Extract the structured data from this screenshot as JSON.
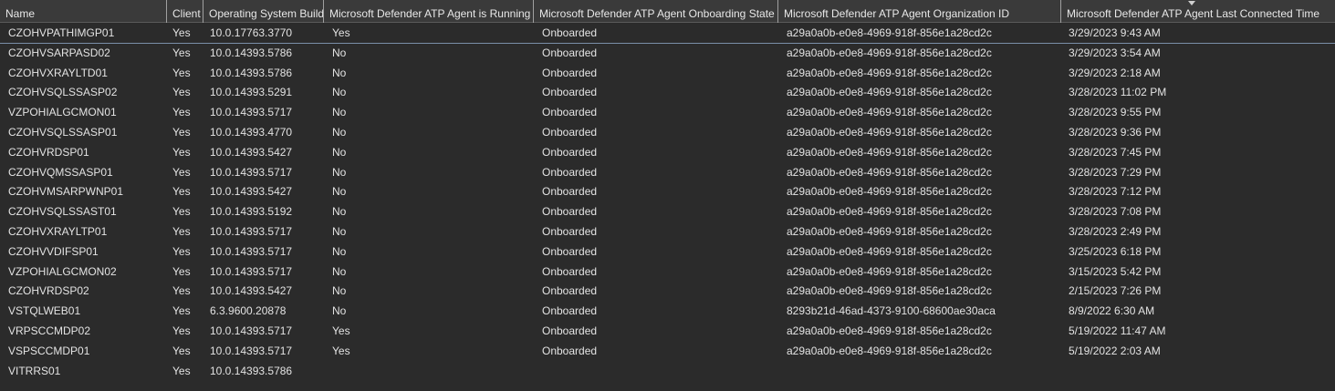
{
  "columns": [
    "Name",
    "Client",
    "Operating System Build",
    "Microsoft Defender ATP Agent is Running",
    "Microsoft Defender ATP Agent Onboarding State",
    "Microsoft Defender ATP Agent Organization ID",
    "Microsoft Defender ATP Agent Last Connected Time"
  ],
  "sort_indicator": "sort-descending-icon",
  "rows": [
    {
      "name": "CZOHVPATHIMGP01",
      "client": "Yes",
      "os_build": "10.0.17763.3770",
      "running": "Yes",
      "onboarding": "Onboarded",
      "org_id": "a29a0a0b-e0e8-4969-918f-856e1a28cd2c",
      "last_connected": "3/29/2023 9:43 AM"
    },
    {
      "name": "CZOHVSARPASD02",
      "client": "Yes",
      "os_build": "10.0.14393.5786",
      "running": "No",
      "onboarding": "Onboarded",
      "org_id": "a29a0a0b-e0e8-4969-918f-856e1a28cd2c",
      "last_connected": "3/29/2023 3:54 AM"
    },
    {
      "name": "CZOHVXRAYLTD01",
      "client": "Yes",
      "os_build": "10.0.14393.5786",
      "running": "No",
      "onboarding": "Onboarded",
      "org_id": "a29a0a0b-e0e8-4969-918f-856e1a28cd2c",
      "last_connected": "3/29/2023 2:18 AM"
    },
    {
      "name": "CZOHVSQLSSASP02",
      "client": "Yes",
      "os_build": "10.0.14393.5291",
      "running": "No",
      "onboarding": "Onboarded",
      "org_id": "a29a0a0b-e0e8-4969-918f-856e1a28cd2c",
      "last_connected": "3/28/2023 11:02 PM"
    },
    {
      "name": "VZPOHIALGCMON01",
      "client": "Yes",
      "os_build": "10.0.14393.5717",
      "running": "No",
      "onboarding": "Onboarded",
      "org_id": "a29a0a0b-e0e8-4969-918f-856e1a28cd2c",
      "last_connected": "3/28/2023 9:55 PM"
    },
    {
      "name": "CZOHVSQLSSASP01",
      "client": "Yes",
      "os_build": "10.0.14393.4770",
      "running": "No",
      "onboarding": "Onboarded",
      "org_id": "a29a0a0b-e0e8-4969-918f-856e1a28cd2c",
      "last_connected": "3/28/2023 9:36 PM"
    },
    {
      "name": "CZOHVRDSP01",
      "client": "Yes",
      "os_build": "10.0.14393.5427",
      "running": "No",
      "onboarding": "Onboarded",
      "org_id": "a29a0a0b-e0e8-4969-918f-856e1a28cd2c",
      "last_connected": "3/28/2023 7:45 PM"
    },
    {
      "name": "CZOHVQMSSASP01",
      "client": "Yes",
      "os_build": "10.0.14393.5717",
      "running": "No",
      "onboarding": "Onboarded",
      "org_id": "a29a0a0b-e0e8-4969-918f-856e1a28cd2c",
      "last_connected": "3/28/2023 7:29 PM"
    },
    {
      "name": "CZOHVMSARPWNP01",
      "client": "Yes",
      "os_build": "10.0.14393.5427",
      "running": "No",
      "onboarding": "Onboarded",
      "org_id": "a29a0a0b-e0e8-4969-918f-856e1a28cd2c",
      "last_connected": "3/28/2023 7:12 PM"
    },
    {
      "name": "CZOHVSQLSSAST01",
      "client": "Yes",
      "os_build": "10.0.14393.5192",
      "running": "No",
      "onboarding": "Onboarded",
      "org_id": "a29a0a0b-e0e8-4969-918f-856e1a28cd2c",
      "last_connected": "3/28/2023 7:08 PM"
    },
    {
      "name": "CZOHVXRAYLTP01",
      "client": "Yes",
      "os_build": "10.0.14393.5717",
      "running": "No",
      "onboarding": "Onboarded",
      "org_id": "a29a0a0b-e0e8-4969-918f-856e1a28cd2c",
      "last_connected": "3/28/2023 2:49 PM"
    },
    {
      "name": "CZOHVVDIFSP01",
      "client": "Yes",
      "os_build": "10.0.14393.5717",
      "running": "No",
      "onboarding": "Onboarded",
      "org_id": "a29a0a0b-e0e8-4969-918f-856e1a28cd2c",
      "last_connected": "3/25/2023 6:18 PM"
    },
    {
      "name": "VZPOHIALGCMON02",
      "client": "Yes",
      "os_build": "10.0.14393.5717",
      "running": "No",
      "onboarding": "Onboarded",
      "org_id": "a29a0a0b-e0e8-4969-918f-856e1a28cd2c",
      "last_connected": "3/15/2023 5:42 PM"
    },
    {
      "name": "CZOHVRDSP02",
      "client": "Yes",
      "os_build": "10.0.14393.5427",
      "running": "No",
      "onboarding": "Onboarded",
      "org_id": "a29a0a0b-e0e8-4969-918f-856e1a28cd2c",
      "last_connected": "2/15/2023 7:26 PM"
    },
    {
      "name": "VSTQLWEB01",
      "client": "Yes",
      "os_build": "6.3.9600.20878",
      "running": "No",
      "onboarding": "Onboarded",
      "org_id": "8293b21d-46ad-4373-9100-68600ae30aca",
      "last_connected": "8/9/2022 6:30 AM"
    },
    {
      "name": "VRPSCCMDP02",
      "client": "Yes",
      "os_build": "10.0.14393.5717",
      "running": "Yes",
      "onboarding": "Onboarded",
      "org_id": "a29a0a0b-e0e8-4969-918f-856e1a28cd2c",
      "last_connected": "5/19/2022 11:47 AM"
    },
    {
      "name": "VSPSCCMDP01",
      "client": "Yes",
      "os_build": "10.0.14393.5717",
      "running": "Yes",
      "onboarding": "Onboarded",
      "org_id": "a29a0a0b-e0e8-4969-918f-856e1a28cd2c",
      "last_connected": "5/19/2022 2:03 AM"
    },
    {
      "name": "VITRRS01",
      "client": "Yes",
      "os_build": "10.0.14393.5786",
      "running": "",
      "onboarding": "",
      "org_id": "",
      "last_connected": ""
    }
  ]
}
